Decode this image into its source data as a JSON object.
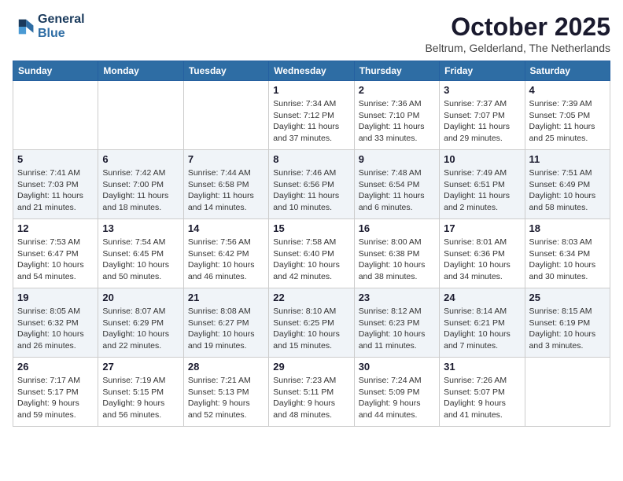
{
  "logo": {
    "line1": "General",
    "line2": "Blue"
  },
  "title": "October 2025",
  "subtitle": "Beltrum, Gelderland, The Netherlands",
  "days_of_week": [
    "Sunday",
    "Monday",
    "Tuesday",
    "Wednesday",
    "Thursday",
    "Friday",
    "Saturday"
  ],
  "weeks": [
    [
      {
        "day": "",
        "info": ""
      },
      {
        "day": "",
        "info": ""
      },
      {
        "day": "",
        "info": ""
      },
      {
        "day": "1",
        "info": "Sunrise: 7:34 AM\nSunset: 7:12 PM\nDaylight: 11 hours\nand 37 minutes."
      },
      {
        "day": "2",
        "info": "Sunrise: 7:36 AM\nSunset: 7:10 PM\nDaylight: 11 hours\nand 33 minutes."
      },
      {
        "day": "3",
        "info": "Sunrise: 7:37 AM\nSunset: 7:07 PM\nDaylight: 11 hours\nand 29 minutes."
      },
      {
        "day": "4",
        "info": "Sunrise: 7:39 AM\nSunset: 7:05 PM\nDaylight: 11 hours\nand 25 minutes."
      }
    ],
    [
      {
        "day": "5",
        "info": "Sunrise: 7:41 AM\nSunset: 7:03 PM\nDaylight: 11 hours\nand 21 minutes."
      },
      {
        "day": "6",
        "info": "Sunrise: 7:42 AM\nSunset: 7:00 PM\nDaylight: 11 hours\nand 18 minutes."
      },
      {
        "day": "7",
        "info": "Sunrise: 7:44 AM\nSunset: 6:58 PM\nDaylight: 11 hours\nand 14 minutes."
      },
      {
        "day": "8",
        "info": "Sunrise: 7:46 AM\nSunset: 6:56 PM\nDaylight: 11 hours\nand 10 minutes."
      },
      {
        "day": "9",
        "info": "Sunrise: 7:48 AM\nSunset: 6:54 PM\nDaylight: 11 hours\nand 6 minutes."
      },
      {
        "day": "10",
        "info": "Sunrise: 7:49 AM\nSunset: 6:51 PM\nDaylight: 11 hours\nand 2 minutes."
      },
      {
        "day": "11",
        "info": "Sunrise: 7:51 AM\nSunset: 6:49 PM\nDaylight: 10 hours\nand 58 minutes."
      }
    ],
    [
      {
        "day": "12",
        "info": "Sunrise: 7:53 AM\nSunset: 6:47 PM\nDaylight: 10 hours\nand 54 minutes."
      },
      {
        "day": "13",
        "info": "Sunrise: 7:54 AM\nSunset: 6:45 PM\nDaylight: 10 hours\nand 50 minutes."
      },
      {
        "day": "14",
        "info": "Sunrise: 7:56 AM\nSunset: 6:42 PM\nDaylight: 10 hours\nand 46 minutes."
      },
      {
        "day": "15",
        "info": "Sunrise: 7:58 AM\nSunset: 6:40 PM\nDaylight: 10 hours\nand 42 minutes."
      },
      {
        "day": "16",
        "info": "Sunrise: 8:00 AM\nSunset: 6:38 PM\nDaylight: 10 hours\nand 38 minutes."
      },
      {
        "day": "17",
        "info": "Sunrise: 8:01 AM\nSunset: 6:36 PM\nDaylight: 10 hours\nand 34 minutes."
      },
      {
        "day": "18",
        "info": "Sunrise: 8:03 AM\nSunset: 6:34 PM\nDaylight: 10 hours\nand 30 minutes."
      }
    ],
    [
      {
        "day": "19",
        "info": "Sunrise: 8:05 AM\nSunset: 6:32 PM\nDaylight: 10 hours\nand 26 minutes."
      },
      {
        "day": "20",
        "info": "Sunrise: 8:07 AM\nSunset: 6:29 PM\nDaylight: 10 hours\nand 22 minutes."
      },
      {
        "day": "21",
        "info": "Sunrise: 8:08 AM\nSunset: 6:27 PM\nDaylight: 10 hours\nand 19 minutes."
      },
      {
        "day": "22",
        "info": "Sunrise: 8:10 AM\nSunset: 6:25 PM\nDaylight: 10 hours\nand 15 minutes."
      },
      {
        "day": "23",
        "info": "Sunrise: 8:12 AM\nSunset: 6:23 PM\nDaylight: 10 hours\nand 11 minutes."
      },
      {
        "day": "24",
        "info": "Sunrise: 8:14 AM\nSunset: 6:21 PM\nDaylight: 10 hours\nand 7 minutes."
      },
      {
        "day": "25",
        "info": "Sunrise: 8:15 AM\nSunset: 6:19 PM\nDaylight: 10 hours\nand 3 minutes."
      }
    ],
    [
      {
        "day": "26",
        "info": "Sunrise: 7:17 AM\nSunset: 5:17 PM\nDaylight: 9 hours\nand 59 minutes."
      },
      {
        "day": "27",
        "info": "Sunrise: 7:19 AM\nSunset: 5:15 PM\nDaylight: 9 hours\nand 56 minutes."
      },
      {
        "day": "28",
        "info": "Sunrise: 7:21 AM\nSunset: 5:13 PM\nDaylight: 9 hours\nand 52 minutes."
      },
      {
        "day": "29",
        "info": "Sunrise: 7:23 AM\nSunset: 5:11 PM\nDaylight: 9 hours\nand 48 minutes."
      },
      {
        "day": "30",
        "info": "Sunrise: 7:24 AM\nSunset: 5:09 PM\nDaylight: 9 hours\nand 44 minutes."
      },
      {
        "day": "31",
        "info": "Sunrise: 7:26 AM\nSunset: 5:07 PM\nDaylight: 9 hours\nand 41 minutes."
      },
      {
        "day": "",
        "info": ""
      }
    ]
  ]
}
